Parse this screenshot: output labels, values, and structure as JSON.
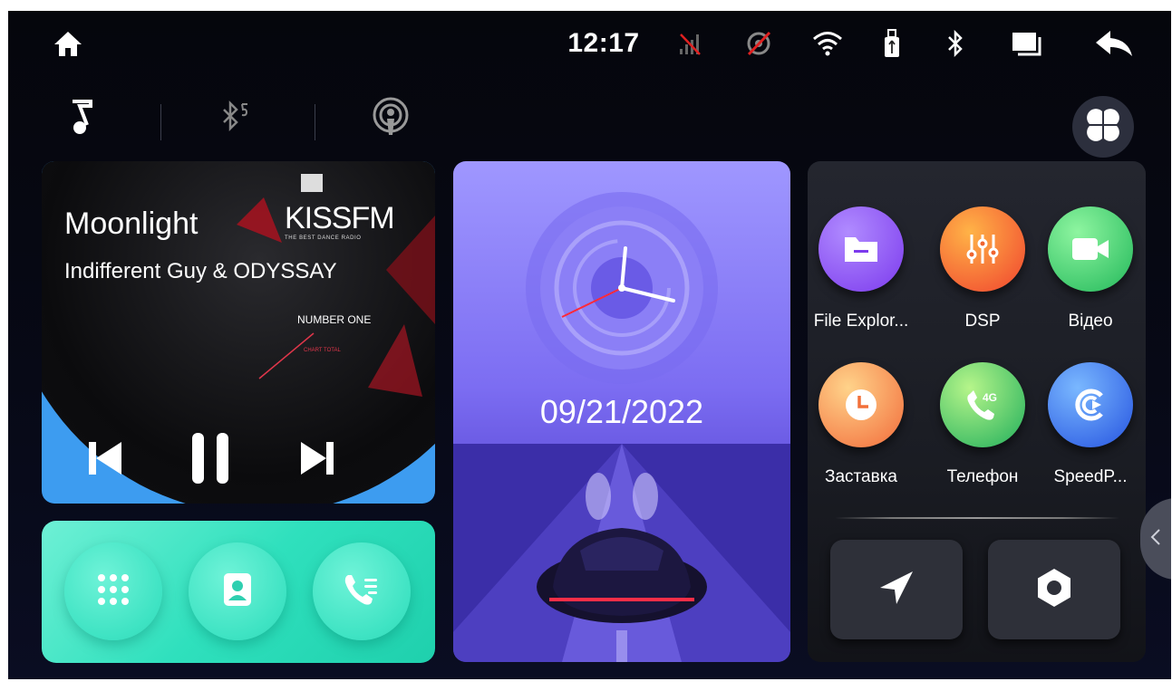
{
  "status_bar": {
    "time": "12:17",
    "icons": [
      "home-icon",
      "no-signal-icon",
      "gps-off-icon",
      "wifi-icon",
      "usb-icon",
      "bluetooth-icon",
      "multitask-icon",
      "back-icon"
    ]
  },
  "source_tabs": [
    "music-icon",
    "bluetooth-music-icon",
    "radio-podcast-icon"
  ],
  "music": {
    "title": "Moonlight",
    "artist": "Indifferent Guy & ODYSSAY",
    "station_logo": "KISSFM",
    "station_tagline": "THE BEST DANCE RADIO",
    "cover_text": "NUMBER ONE",
    "cover_subtext": "CHART TOTAL",
    "controls": [
      "previous-icon",
      "pause-icon",
      "next-icon"
    ]
  },
  "calls": {
    "buttons": [
      "dialpad-icon",
      "contacts-icon",
      "call-log-icon"
    ]
  },
  "clock": {
    "date": "09/21/2022"
  },
  "apps": [
    {
      "label": "File Explor...",
      "icon": "folder-icon",
      "color": "#8b5cf6"
    },
    {
      "label": "DSP",
      "icon": "equalizer-icon",
      "color": "#f97316"
    },
    {
      "label": "Відео",
      "icon": "video-camera-icon",
      "color": "#22c55e"
    },
    {
      "label": "Заставка",
      "icon": "clock-icon",
      "color": "#f59e0b"
    },
    {
      "label": "Телефон",
      "icon": "phone-4g-icon",
      "color": "#22c55e"
    },
    {
      "label": "SpeedP...",
      "icon": "speedplay-icon",
      "color": "#3b82f6"
    }
  ],
  "quick_buttons": [
    "navigation-icon",
    "settings-icon"
  ],
  "colors": {
    "accent_purple": "#7c6df2",
    "accent_teal": "#2fe0bd",
    "accent_blue": "#3d9cf0"
  }
}
